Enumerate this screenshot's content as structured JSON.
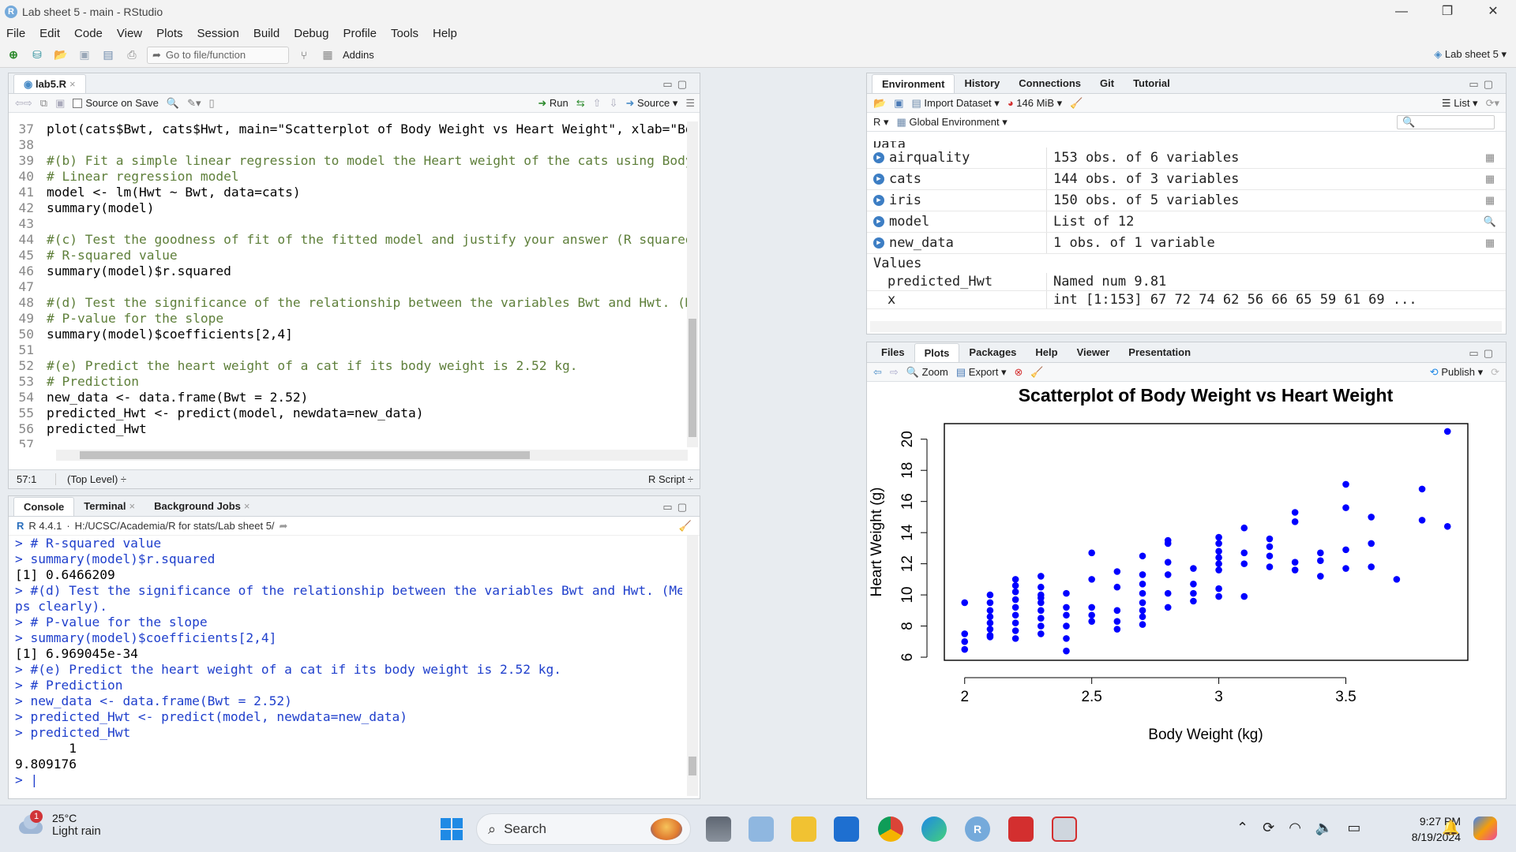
{
  "window": {
    "title": "Lab sheet 5 - main - RStudio",
    "minimize": "—",
    "maximize": "❐",
    "close": "✕"
  },
  "menu": [
    "File",
    "Edit",
    "Code",
    "View",
    "Plots",
    "Session",
    "Build",
    "Debug",
    "Profile",
    "Tools",
    "Help"
  ],
  "toolbar": {
    "goto_placeholder": "Go to file/function",
    "addins": "Addins",
    "project": "Lab sheet 5"
  },
  "editor": {
    "tab": "lab5.R",
    "source_on_save": "Source on Save",
    "run": "Run",
    "source": "Source",
    "lines": [
      {
        "n": "37",
        "t": "plot(cats$Bwt, cats$Hwt, main=\"Scatterplot of Body Weight vs Heart Weight\", xlab=\"Body Weight (kg)\"",
        "c": false
      },
      {
        "n": "38",
        "t": "",
        "c": false
      },
      {
        "n": "39",
        "t": "#(b) Fit a simple linear regression to model the Heart weight of the cats using Body weight as the",
        "c": true
      },
      {
        "n": "40",
        "t": "# Linear regression model",
        "c": true
      },
      {
        "n": "41",
        "t": "model <- lm(Hwt ~ Bwt, data=cats)",
        "c": false
      },
      {
        "n": "42",
        "t": "summary(model)",
        "c": false
      },
      {
        "n": "43",
        "t": "",
        "c": false
      },
      {
        "n": "44",
        "t": "#(c) Test the goodness of fit of the fitted model and justify your answer (R squared).",
        "c": true
      },
      {
        "n": "45",
        "t": "# R-squared value",
        "c": true
      },
      {
        "n": "46",
        "t": "summary(model)$r.squared",
        "c": false
      },
      {
        "n": "47",
        "t": "",
        "c": false
      },
      {
        "n": "48",
        "t": "#(d) Test the significance of the relationship between the variables Bwt and Hwt. (Mention all the",
        "c": true
      },
      {
        "n": "49",
        "t": "# P-value for the slope",
        "c": true
      },
      {
        "n": "50",
        "t": "summary(model)$coefficients[2,4]",
        "c": false
      },
      {
        "n": "51",
        "t": "",
        "c": false
      },
      {
        "n": "52",
        "t": "#(e) Predict the heart weight of a cat if its body weight is 2.52 kg.",
        "c": true
      },
      {
        "n": "53",
        "t": "# Prediction",
        "c": true
      },
      {
        "n": "54",
        "t": "new_data <- data.frame(Bwt = 2.52)",
        "c": false
      },
      {
        "n": "55",
        "t": "predicted_Hwt <- predict(model, newdata=new_data)",
        "c": false
      },
      {
        "n": "56",
        "t": "predicted_Hwt",
        "c": false
      },
      {
        "n": "57",
        "t": "",
        "c": false
      }
    ],
    "status_pos": "57:1",
    "status_scope": "(Top Level) ÷",
    "status_type": "R Script ÷"
  },
  "console": {
    "tabs": [
      "Console",
      "Terminal",
      "Background Jobs"
    ],
    "version": "R 4.4.1",
    "path": "H:/UCSC/Academia/R for stats/Lab sheet 5/",
    "lines": [
      {
        "t": "> # R-squared value",
        "k": "blue"
      },
      {
        "t": "> summary(model)$r.squared",
        "k": "blue"
      },
      {
        "t": "[1] 0.6466209",
        "k": "black"
      },
      {
        "t": "> #(d) Test the significance of the relationship between the variables Bwt and Hwt. (Mention all the ste",
        "k": "blue"
      },
      {
        "t": "ps clearly).",
        "k": "blue"
      },
      {
        "t": "> # P-value for the slope",
        "k": "blue"
      },
      {
        "t": "> summary(model)$coefficients[2,4]",
        "k": "blue"
      },
      {
        "t": "[1] 6.969045e-34",
        "k": "black"
      },
      {
        "t": "> #(e) Predict the heart weight of a cat if its body weight is 2.52 kg.",
        "k": "blue"
      },
      {
        "t": "> # Prediction",
        "k": "blue"
      },
      {
        "t": "> new_data <- data.frame(Bwt = 2.52)",
        "k": "blue"
      },
      {
        "t": "> predicted_Hwt <- predict(model, newdata=new_data)",
        "k": "blue"
      },
      {
        "t": "> predicted_Hwt",
        "k": "blue"
      },
      {
        "t": "       1",
        "k": "black"
      },
      {
        "t": "9.809176",
        "k": "black"
      },
      {
        "t": "> |",
        "k": "blue"
      }
    ]
  },
  "environment": {
    "tabs": [
      "Environment",
      "History",
      "Connections",
      "Git",
      "Tutorial"
    ],
    "import_dataset": "Import Dataset",
    "memory": "146 MiB",
    "list_view": "List",
    "lang": "R",
    "scope": "Global Environment",
    "data_header": "Data",
    "data": [
      {
        "name": "airquality",
        "value": "153 obs. of 6 variables",
        "icon": "grid"
      },
      {
        "name": "cats",
        "value": "144 obs. of 3 variables",
        "icon": "grid"
      },
      {
        "name": "iris",
        "value": "150 obs. of 5 variables",
        "icon": "grid"
      },
      {
        "name": "model",
        "value": "List of  12",
        "icon": "search"
      },
      {
        "name": "new_data",
        "value": "1 obs. of 1 variable",
        "icon": "grid"
      }
    ],
    "values_header": "Values",
    "values": [
      {
        "name": "predicted_Hwt",
        "value": "Named num 9.81"
      },
      {
        "name": "x",
        "value": "int [1:153] 67 72 74 62 56 66 65 59 61 69 ..."
      }
    ]
  },
  "plots": {
    "tabs": [
      "Files",
      "Plots",
      "Packages",
      "Help",
      "Viewer",
      "Presentation"
    ],
    "zoom": "Zoom",
    "export": "Export",
    "publish": "Publish"
  },
  "chart_data": {
    "type": "scatter",
    "title": "Scatterplot of Body Weight vs Heart Weight",
    "xlabel": "Body Weight (kg)",
    "ylabel": "Heart Weight (g)",
    "xlim": [
      1.92,
      3.98
    ],
    "ylim": [
      5.8,
      21.0
    ],
    "xticks": [
      2.0,
      2.5,
      3.0,
      3.5
    ],
    "yticks": [
      6,
      8,
      10,
      12,
      14,
      16,
      18,
      20
    ],
    "color": "#0000ff",
    "x": [
      2.0,
      2.0,
      2.0,
      2.0,
      2.1,
      2.1,
      2.1,
      2.1,
      2.1,
      2.1,
      2.1,
      2.1,
      2.2,
      2.2,
      2.2,
      2.2,
      2.2,
      2.2,
      2.2,
      2.2,
      2.2,
      2.3,
      2.3,
      2.3,
      2.3,
      2.3,
      2.3,
      2.3,
      2.3,
      2.3,
      2.4,
      2.4,
      2.4,
      2.4,
      2.4,
      2.4,
      2.5,
      2.5,
      2.5,
      2.5,
      2.5,
      2.6,
      2.6,
      2.6,
      2.6,
      2.6,
      2.7,
      2.7,
      2.7,
      2.7,
      2.7,
      2.7,
      2.7,
      2.7,
      2.8,
      2.8,
      2.8,
      2.8,
      2.8,
      2.8,
      2.9,
      2.9,
      2.9,
      2.9,
      3.0,
      3.0,
      3.0,
      3.0,
      3.0,
      3.0,
      3.0,
      3.0,
      3.1,
      3.1,
      3.1,
      3.1,
      3.2,
      3.2,
      3.2,
      3.2,
      3.3,
      3.3,
      3.3,
      3.3,
      3.4,
      3.4,
      3.4,
      3.5,
      3.5,
      3.5,
      3.5,
      3.6,
      3.6,
      3.6,
      3.7,
      3.8,
      3.8,
      3.9,
      3.9
    ],
    "y": [
      6.5,
      7.0,
      7.5,
      9.5,
      7.4,
      7.8,
      8.2,
      8.6,
      9.0,
      9.5,
      10.0,
      7.3,
      7.2,
      7.7,
      8.2,
      8.7,
      9.2,
      9.7,
      10.2,
      10.6,
      11.0,
      7.5,
      8.0,
      8.5,
      9.0,
      9.5,
      10.0,
      10.5,
      11.2,
      9.8,
      6.4,
      7.2,
      8.0,
      8.7,
      9.2,
      10.1,
      8.3,
      8.7,
      9.2,
      11.0,
      12.7,
      7.8,
      8.3,
      9.0,
      10.5,
      11.5,
      8.1,
      8.6,
      9.0,
      9.5,
      10.1,
      10.7,
      11.3,
      12.5,
      9.2,
      10.1,
      11.3,
      12.1,
      13.3,
      13.5,
      9.6,
      10.1,
      10.7,
      11.7,
      9.9,
      10.4,
      11.6,
      12.0,
      12.4,
      12.8,
      13.3,
      13.7,
      9.9,
      12.0,
      12.7,
      14.3,
      11.8,
      12.5,
      13.1,
      13.6,
      11.6,
      12.1,
      14.7,
      15.3,
      11.2,
      12.2,
      12.7,
      11.7,
      12.9,
      15.6,
      17.1,
      11.8,
      13.3,
      15.0,
      11.0,
      14.8,
      16.8,
      14.4,
      20.5
    ]
  },
  "taskbar": {
    "weather_badge": "1",
    "temp": "25°C",
    "condition": "Light rain",
    "search": "Search",
    "time": "9:27 PM",
    "date": "8/19/2024"
  }
}
